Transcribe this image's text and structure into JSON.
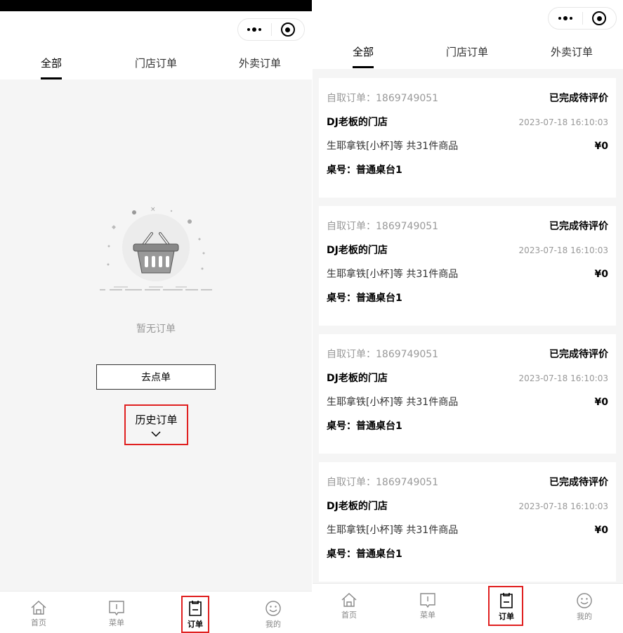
{
  "tabs": {
    "all": "全部",
    "store_orders": "门店订单",
    "delivery_orders": "外卖订单"
  },
  "empty_state": {
    "message": "暂无订单",
    "go_order_button": "去点单",
    "history_label": "历史订单"
  },
  "tabbar": {
    "home": "首页",
    "menu": "菜单",
    "orders": "订单",
    "mine": "我的"
  },
  "orders": [
    {
      "order_no": "自取订单：1869749051",
      "status": "已完成待评价",
      "store": "DJ老板的门店",
      "time": "2023-07-18 16:10:03",
      "goods": "生耶拿铁[小杯]等 共31件商品",
      "price": "¥0",
      "table": "桌号：普通桌台1"
    },
    {
      "order_no": "自取订单：1869749051",
      "status": "已完成待评价",
      "store": "DJ老板的门店",
      "time": "2023-07-18 16:10:03",
      "goods": "生耶拿铁[小杯]等 共31件商品",
      "price": "¥0",
      "table": "桌号：普通桌台1"
    },
    {
      "order_no": "自取订单：1869749051",
      "status": "已完成待评价",
      "store": "DJ老板的门店",
      "time": "2023-07-18 16:10:03",
      "goods": "生耶拿铁[小杯]等 共31件商品",
      "price": "¥0",
      "table": "桌号：普通桌台1"
    },
    {
      "order_no": "自取订单：1869749051",
      "status": "已完成待评价",
      "store": "DJ老板的门店",
      "time": "2023-07-18 16:10:03",
      "goods": "生耶拿铁[小杯]等 共31件商品",
      "price": "¥0",
      "table": "桌号：普通桌台1"
    }
  ],
  "colors": {
    "highlight": "#e02020",
    "background": "#f5f5f5",
    "text_muted": "#999999"
  },
  "icons": [
    "more-dots-icon",
    "target-circle-icon",
    "home-icon",
    "menu-book-icon",
    "order-clipboard-icon",
    "smile-face-icon",
    "chevron-down-icon",
    "empty-basket-icon"
  ]
}
